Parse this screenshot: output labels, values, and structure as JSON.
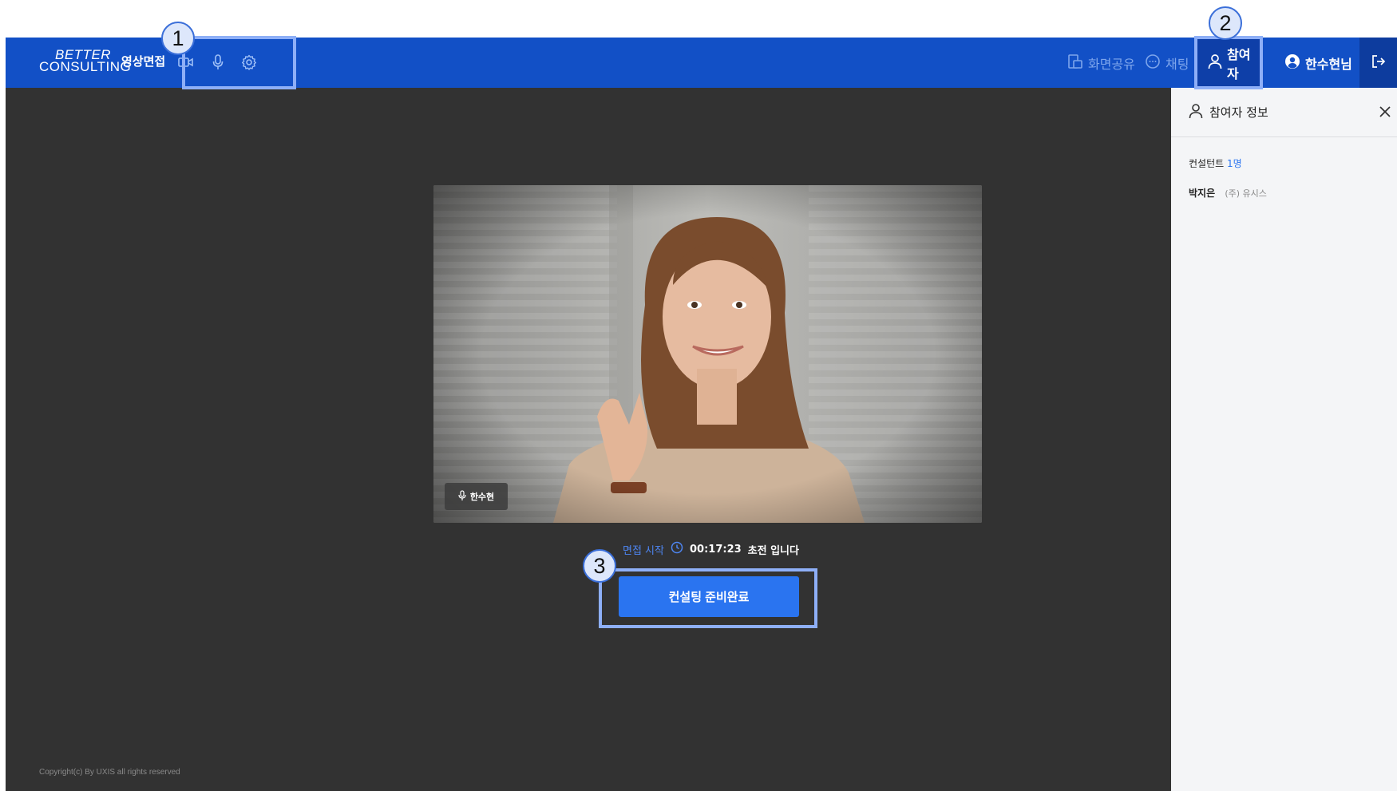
{
  "header": {
    "logo_line1": "BETTER",
    "logo_line2": "CONSULTING",
    "app_title": "영상면접",
    "controls": [
      "camera-icon",
      "mic-icon",
      "settings-icon"
    ],
    "screen_share_label": "화면공유",
    "chat_label": "채팅",
    "participants_label": "참여자",
    "user_label": "한수현님"
  },
  "video": {
    "speaker_name": "한수현"
  },
  "status": {
    "start_label": "면접 시작",
    "time": "00:17:23",
    "elapsed_label": "초전 입니다"
  },
  "ready_button_label": "컨설팅 준비완료",
  "copyright": "Copyright(c) By UXIS all rights reserved",
  "panel": {
    "title": "참여자 정보",
    "consultant_label": "컨설턴트",
    "consultant_count": "1명",
    "participant_name": "박지은",
    "participant_company": "(주) 유시스"
  },
  "annotations": [
    "1",
    "2",
    "3"
  ],
  "colors": {
    "header_bg": "#1250c6",
    "stage_bg": "#323232",
    "accent": "#2a74f0",
    "highlight": "#8eaff7"
  }
}
